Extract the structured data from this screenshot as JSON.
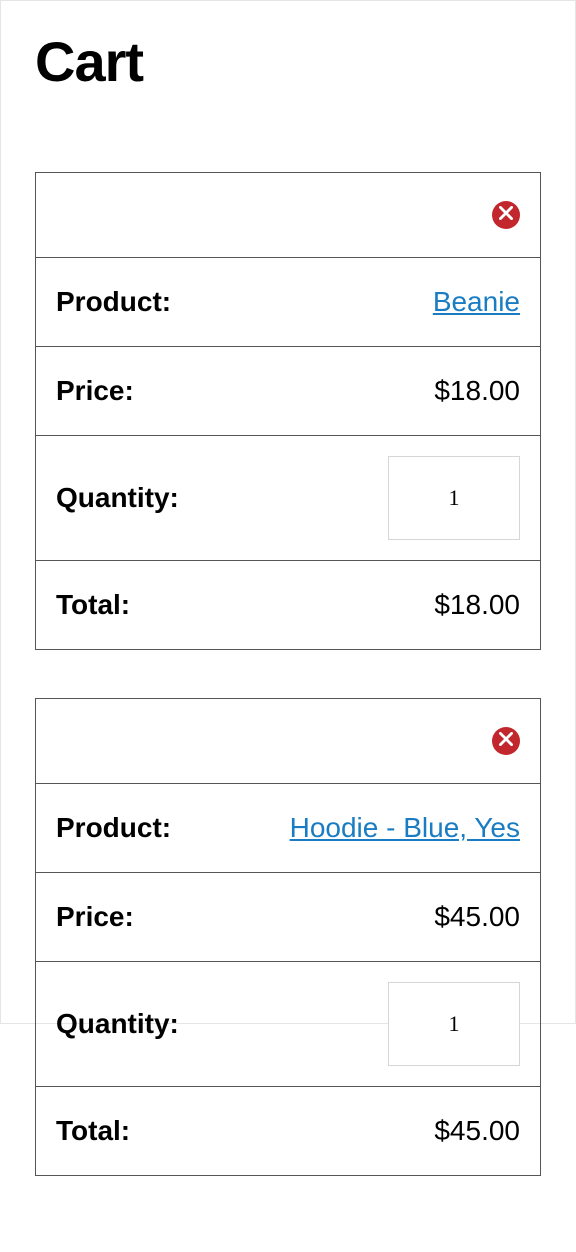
{
  "title": "Cart",
  "labels": {
    "product": "Product:",
    "price": "Price:",
    "quantity": "Quantity:",
    "total": "Total:"
  },
  "items": [
    {
      "product": "Beanie",
      "price": "$18.00",
      "quantity": "1",
      "total": "$18.00"
    },
    {
      "product": "Hoodie - Blue, Yes",
      "price": "$45.00",
      "quantity": "1",
      "total": "$45.00"
    }
  ]
}
